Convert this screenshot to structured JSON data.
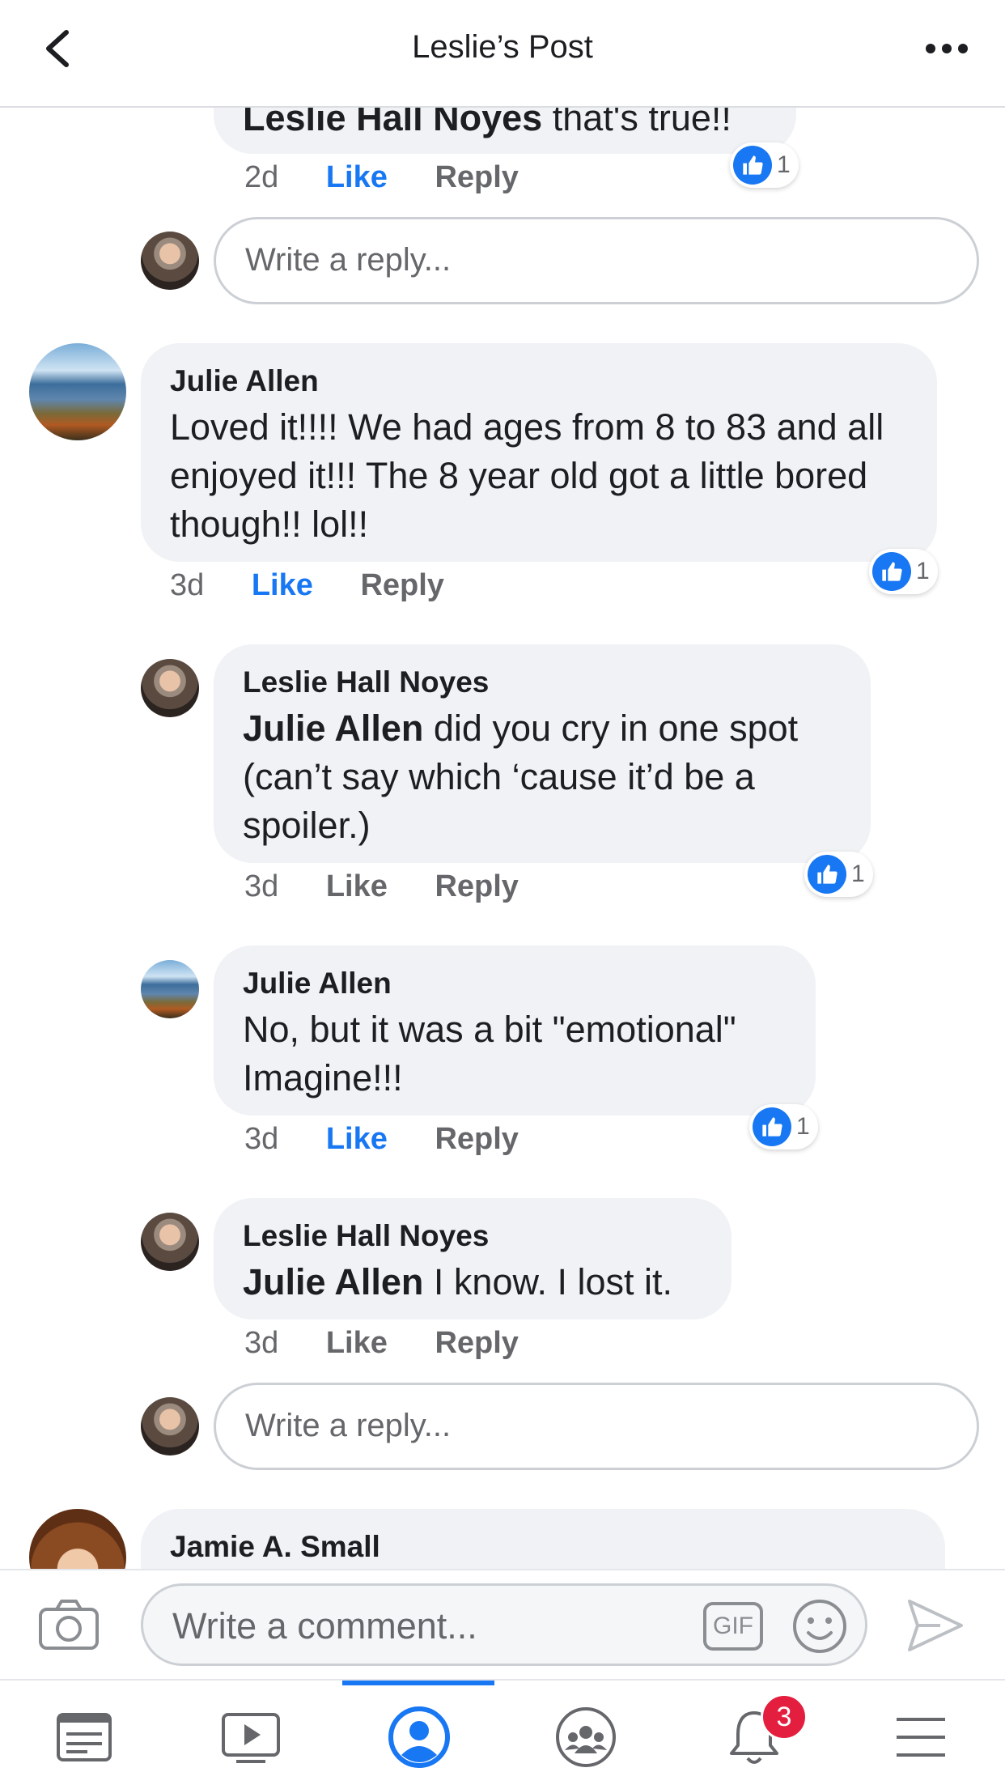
{
  "header": {
    "title": "Leslie’s Post"
  },
  "comments": {
    "c0": {
      "mention": "Leslie Hall Noyes",
      "text": " that's true!!",
      "time": "2d",
      "like": "Like",
      "reply": "Reply",
      "reactions": "1"
    },
    "reply_box_1": {
      "placeholder": "Write a reply..."
    },
    "c1": {
      "author": "Julie Allen",
      "text": "Loved it!!!!  We had ages from 8 to 83 and all enjoyed it!!! The 8 year old got a little bored though!! lol!!",
      "time": "3d",
      "like": "Like",
      "reply": "Reply",
      "reactions": "1"
    },
    "c2": {
      "author": "Leslie Hall Noyes",
      "mention": "Julie Allen",
      "text": " did you cry in one spot (can’t say which ‘cause it’d be a spoiler.)",
      "time": "3d",
      "like": "Like",
      "reply": "Reply",
      "reactions": "1"
    },
    "c3": {
      "author": "Julie Allen",
      "text": "No, but it was a bit \"emotional\" Imagine!!!",
      "time": "3d",
      "like": "Like",
      "reply": "Reply",
      "reactions": "1"
    },
    "c4": {
      "author": "Leslie Hall Noyes",
      "mention": "Julie Allen",
      "text": " I know. I lost it.",
      "time": "3d",
      "like": "Like",
      "reply": "Reply"
    },
    "reply_box_2": {
      "placeholder": "Write a reply..."
    },
    "c5": {
      "author": "Jamie A. Small"
    }
  },
  "composer": {
    "placeholder": "Write a comment...",
    "gif_label": "GIF"
  },
  "tabbar": {
    "notifications_badge": "3"
  },
  "colors": {
    "accent": "#1877f2",
    "bubble": "#f0f2f5",
    "badge": "#e41e3f"
  },
  "icons": [
    "back-chevron-icon",
    "more-dots-icon",
    "camera-icon",
    "gif-icon",
    "emoji-icon",
    "send-icon",
    "news-feed-icon",
    "watch-icon",
    "profile-icon",
    "groups-icon",
    "bell-icon",
    "menu-icon",
    "thumbs-up-icon"
  ]
}
